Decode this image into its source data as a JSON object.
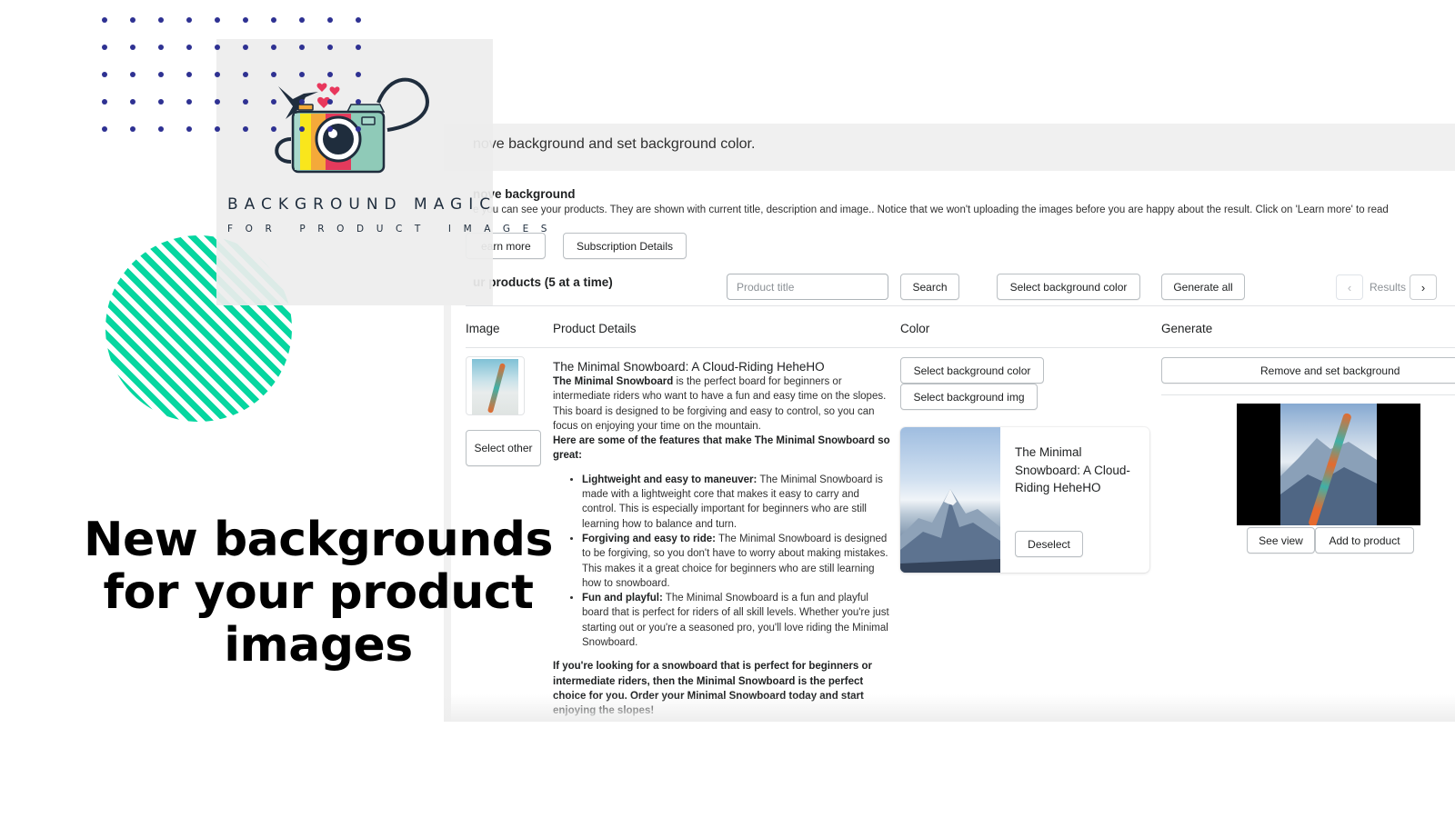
{
  "promo": {
    "brand_title": "BACKGROUND MAGIC",
    "brand_subtitle": "FOR PRODUCT IMAGES",
    "headline": "New backgrounds for your product images",
    "colors": {
      "dots": "#2e3192",
      "stripes": "#06d6a0",
      "logo_panel": "#ededed"
    }
  },
  "app": {
    "page_header": "nove background and set background color.",
    "section": {
      "title": "nove background",
      "description": "e you can see your products. They are shown with current title, description and image.. Notice that we won't uploading the images before you are happy about the result. Click on 'Learn more' to read",
      "learn_more_label": "earn more",
      "subscription_label": "Subscription Details"
    },
    "products": {
      "title": "ur products (5 at a time)",
      "search_placeholder": "Product title",
      "search_value": "",
      "search_label": "Search",
      "select_bg_color_label": "Select background color",
      "generate_all_label": "Generate all",
      "pager": {
        "prev_icon": "chevron-left",
        "label": "Results",
        "next_icon": "chevron-right"
      }
    },
    "table": {
      "columns": [
        "Image",
        "Product Details",
        "Color",
        "Generate"
      ],
      "rows": [
        {
          "select_other_label": "Select other",
          "title": "The Minimal Snowboard: A Cloud-Riding HeheHO",
          "intro_bold": "The Minimal Snowboard",
          "intro_rest": " is the perfect board for beginners or intermediate riders who want to have a fun and easy time on the slopes. This board is designed to be forgiving and easy to control, so you can focus on enjoying your time on the mountain.",
          "features_heading": "Here are some of the features that make The Minimal Snowboard so great:",
          "features": [
            {
              "bold": "Lightweight and easy to maneuver:",
              "text": " The Minimal Snowboard is made with a lightweight core that makes it easy to carry and control. This is especially important for beginners who are still learning how to balance and turn."
            },
            {
              "bold": "Forgiving and easy to ride:",
              "text": " The Minimal Snowboard is designed to be forgiving, so you don't have to worry about making mistakes. This makes it a great choice for beginners who are still learning how to snowboard."
            },
            {
              "bold": "Fun and playful:",
              "text": " The Minimal Snowboard is a fun and playful board that is perfect for riders of all skill levels. Whether you're just starting out or you're a seasoned pro, you'll love riding the Minimal Snowboard."
            }
          ],
          "closing": "If you're looking for a snowboard that is perfect for beginners or intermediate riders, then the Minimal Snowboard is the perfect choice for you. Order your Minimal Snowboard today and start enjoying the slopes!",
          "color": {
            "select_color_label": "Select background color",
            "select_img_label": "Select background img",
            "selected_bg_title": "The Minimal Snowboard: A Cloud-Riding HeheHO",
            "deselect_label": "Deselect"
          },
          "generate": {
            "remove_set_label": "Remove and set background",
            "see_view_label": "See view",
            "add_to_product_label": "Add to product"
          }
        }
      ]
    }
  }
}
